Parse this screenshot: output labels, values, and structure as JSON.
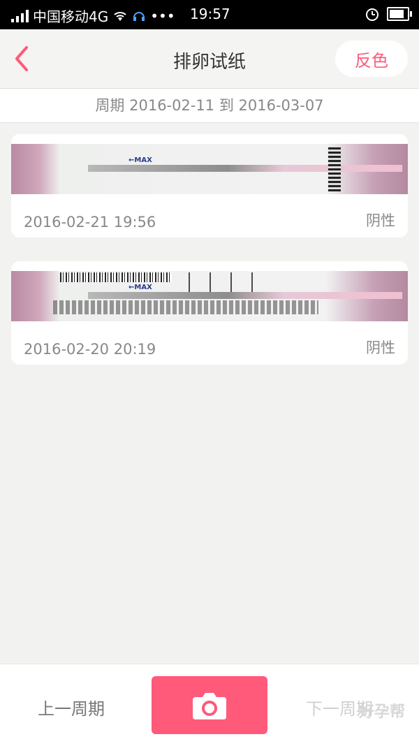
{
  "status_bar": {
    "carrier": "中国移动4G",
    "time": "19:57"
  },
  "nav": {
    "title": "排卵试纸",
    "invert_label": "反色"
  },
  "period": {
    "text": "周期 2016-02-11 到 2016-03-07"
  },
  "entries": [
    {
      "datetime": "2016-02-21 19:56",
      "result": "阴性"
    },
    {
      "datetime": "2016-02-20 20:19",
      "result": "阴性"
    }
  ],
  "bottom": {
    "prev_label": "上一周期",
    "next_label": "下一周期",
    "watermark": "好孕帮"
  },
  "colors": {
    "accent": "#ff5a7a",
    "text_gray": "#888888"
  },
  "icons": {
    "back": "chevron-left-icon",
    "camera": "camera-icon",
    "wifi": "wifi-icon",
    "alarm": "alarm-icon",
    "battery": "battery-icon"
  }
}
